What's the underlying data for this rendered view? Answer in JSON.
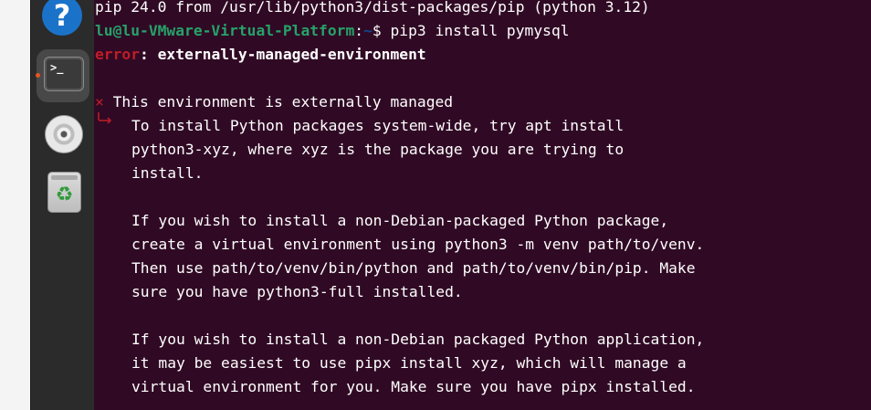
{
  "dock": {
    "items": [
      {
        "icon": "help-icon",
        "glyph": "?"
      },
      {
        "icon": "terminal-icon",
        "glyph": ">_",
        "active": true
      },
      {
        "icon": "disc-icon"
      },
      {
        "icon": "trash-icon",
        "glyph": "♻"
      }
    ]
  },
  "terminal": {
    "pip_version_line": "pip 24.0 from /usr/lib/python3/dist-packages/pip (python 3.12)",
    "prompt": {
      "user_host": "lu@lu-VMware-Virtual-Platform",
      "separator": ":",
      "path": "~",
      "symbol": "$ ",
      "command": "pip3 install pymysql"
    },
    "error_label": "error",
    "error_sep": ": ",
    "error_name": "externally-managed-environment",
    "cross_symbol": "×",
    "headline": " This environment is externally managed",
    "message_lines": [
      "To install Python packages system-wide, try apt install",
      "python3-xyz, where xyz is the package you are trying to",
      "install.",
      "",
      "If you wish to install a non-Debian-packaged Python package,",
      "create a virtual environment using python3 -m venv path/to/venv.",
      "Then use path/to/venv/bin/python and path/to/venv/bin/pip. Make",
      "sure you have python3-full installed.",
      "",
      "If you wish to install a non-Debian packaged Python application,",
      "it may be easiest to use pipx install xyz, which will manage a",
      "virtual environment for you. Make sure you have pipx installed."
    ]
  },
  "colors": {
    "terminal_bg": "#300a24",
    "prompt_green": "#26a269",
    "path_blue": "#12488b",
    "error_red": "#c01c28",
    "dock_bg": "#2b2b2b"
  }
}
